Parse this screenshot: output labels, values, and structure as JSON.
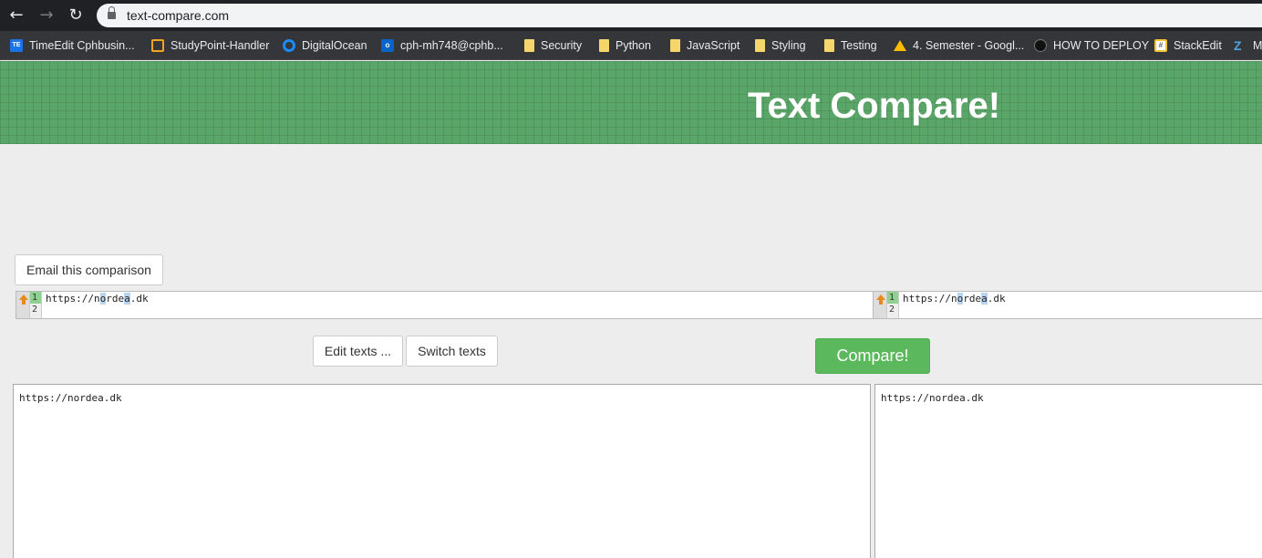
{
  "browser": {
    "url": "text-compare.com",
    "bookmarks": [
      {
        "label": "TimeEdit Cphbusin...",
        "icon": "timeedit-icon"
      },
      {
        "label": "StudyPoint-Handler",
        "icon": "studypoint-icon"
      },
      {
        "label": "DigitalOcean",
        "icon": "digitalocean-icon"
      },
      {
        "label": "cph-mh748@cphb...",
        "icon": "outlook-icon"
      },
      {
        "label": "Security",
        "icon": "folder-icon"
      },
      {
        "label": "Python",
        "icon": "folder-icon"
      },
      {
        "label": "JavaScript",
        "icon": "folder-icon"
      },
      {
        "label": "Styling",
        "icon": "folder-icon"
      },
      {
        "label": "Testing",
        "icon": "folder-icon"
      },
      {
        "label": "4. Semester - Googl...",
        "icon": "google-drive-icon"
      },
      {
        "label": "HOW TO DEPLOY",
        "icon": "github-icon"
      },
      {
        "label": "StackEdit",
        "icon": "stackedit-icon"
      },
      {
        "label": "M",
        "icon": "z-icon"
      }
    ]
  },
  "site": {
    "title": "Text Compare!",
    "header_color": "#5aa568"
  },
  "actions": {
    "email_label": "Email this comparison",
    "edit_label": "Edit texts ...",
    "switch_label": "Switch texts",
    "compare_label": "Compare!",
    "compare_color": "#5cb85c"
  },
  "diff": {
    "left": {
      "line_numbers": [
        "1",
        "2"
      ],
      "segments": [
        "https://n",
        "o",
        "rde",
        "a",
        ".dk"
      ]
    },
    "right": {
      "line_numbers": [
        "1",
        "2"
      ],
      "segments": [
        "https://n",
        "o",
        "rde",
        "a",
        ".dk"
      ]
    }
  },
  "inputs": {
    "left_text": "https://nordea.dk",
    "right_text": "https://nordea.dk"
  }
}
